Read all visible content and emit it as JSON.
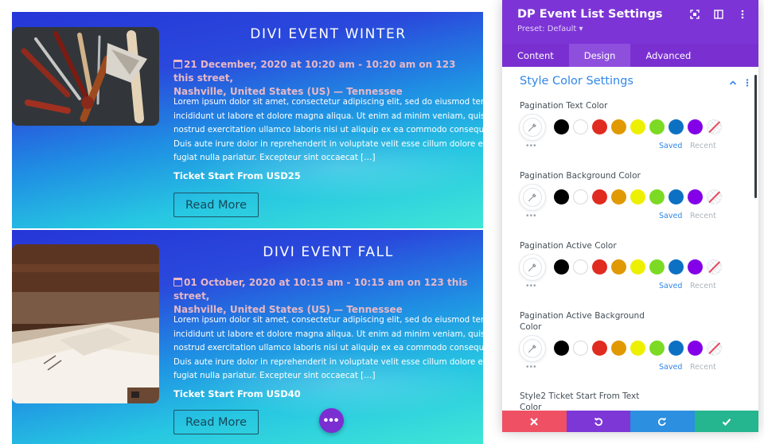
{
  "events": [
    {
      "title": "DIVI EVENT WINTER",
      "meta_line1": "21 December, 2020 at 10:20 am - 10:20 am on 123 this street,",
      "meta_line2": "Nashville, United States (US) — Tennessee",
      "desc_lines": [
        "Lorem ipsum dolor sit amet, consectetur adipiscing elit, sed do eiusmod tempor",
        "incididunt ut labore et dolore magna aliqua. Ut enim ad minim veniam, quis",
        "nostrud exercitation ullamco laboris nisi ut aliquip ex ea commodo consequat.",
        "Duis aute irure dolor in reprehenderit in voluptate velit esse cillum dolore eu",
        "fugiat nulla pariatur. Excepteur sint occaecat […]"
      ],
      "ticket": "Ticket Start From USD25",
      "button": "Read More",
      "image_icon": "tools-image"
    },
    {
      "title": "DIVI EVENT FALL",
      "meta_line1": "01 October, 2020 at 10:15 am - 10:15 am on 123 this street,",
      "meta_line2": "Nashville, United States (US) — Tennessee",
      "desc_lines": [
        "Lorem ipsum dolor sit amet, consectetur adipiscing elit, sed do eiusmod tempor",
        "incididunt ut labore et dolore magna aliqua. Ut enim ad minim veniam, quis",
        "nostrud exercitation ullamco laboris nisi ut aliquip ex ea commodo consequat.",
        "Duis aute irure dolor in reprehenderit in voluptate velit esse cillum dolore eu",
        "fugiat nulla pariatur. Excepteur sint occaecat […]"
      ],
      "ticket": "Ticket Start From USD40",
      "button": "Read More",
      "image_icon": "books-image"
    }
  ],
  "fab_label": "•••",
  "panel": {
    "title": "DP Event List Settings",
    "preset": "Preset: Default ▾",
    "tabs": [
      "Content",
      "Design",
      "Advanced"
    ],
    "active_tab": "Design",
    "section_title": "Style Color Settings",
    "settings": [
      {
        "label": "Pagination Text Color"
      },
      {
        "label": "Pagination Background Color"
      },
      {
        "label": "Pagination Active Color"
      },
      {
        "label_lines": [
          "Pagination Active Background",
          "Color"
        ]
      },
      {
        "label_lines": [
          "Style2 Ticket Start From Text",
          "Color"
        ]
      }
    ],
    "swatch_colors": [
      "#000000",
      "#ffffff",
      "#e02b20",
      "#e09900",
      "#edf000",
      "#7cda24",
      "#0c71c3",
      "#8300e9"
    ],
    "saved_label": "Saved",
    "recent_label": "Recent",
    "more_label": "•••"
  },
  "colors": {
    "panel_header": "#7c34d6",
    "accent_blue": "#3187e8",
    "close": "#ef5064",
    "undo": "#7d37d7",
    "redo": "#2c8fe0",
    "save": "#25b58f"
  }
}
